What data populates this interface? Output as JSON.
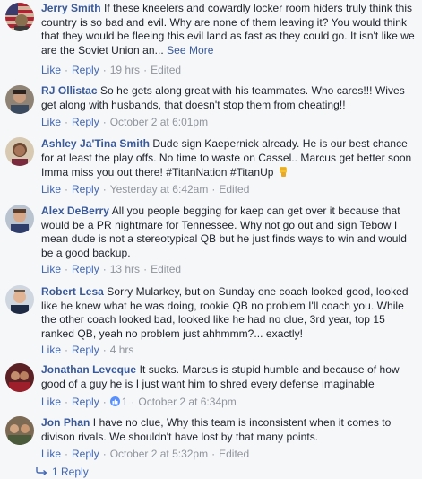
{
  "actions": {
    "like": "Like",
    "reply": "Reply",
    "separator": "·"
  },
  "see_more": "See More",
  "comments": [
    {
      "author": "Jerry Smith",
      "text": "If these kneelers and cowardly locker room hiders truly think this country is so bad and evil. Why are none of them leaving it? You would think that they would be fleeing this evil land as fast as they could go. It isn't like we are the Soviet Union an...",
      "has_see_more": true,
      "timestamp": "19 hrs",
      "edited": "Edited",
      "avatar_icon": "user-avatar-flag"
    },
    {
      "author": "RJ Ollistac",
      "text": "So he gets along great with his teammates. Who cares!!! Wives get along with husbands, that doesn't stop them from cheating!!",
      "timestamp": "October 2 at 6:01pm",
      "avatar_icon": "user-avatar-man"
    },
    {
      "author": "Ashley Ja'Tina Smith",
      "text": "Dude sign Kaepernick already. He is our best chance for at least the play offs. No time to waste on Cassel.. Marcus get better soon Imma miss you out there! #TitanNation #TitanUp",
      "emoji": "raised-fist-emoji",
      "timestamp": "Yesterday at 6:42am",
      "edited": "Edited",
      "avatar_icon": "user-avatar-woman"
    },
    {
      "author": "Alex DeBerry",
      "text": "All you people begging for kaep can get over it because that would be a PR nightmare for Tennessee. Why not go out and sign Tebow I mean dude is not a stereotypical QB but he just finds ways to win and would be a good backup.",
      "timestamp": "13 hrs",
      "edited": "Edited",
      "avatar_icon": "user-avatar-man"
    },
    {
      "author": "Robert Lesa",
      "text": "Sorry Mularkey, but on Sunday one coach looked good, looked like he knew what he was doing, rookie QB no problem I'll coach you. While the other coach looked bad, looked like he had no clue, 3rd year, top 15 ranked QB, yeah no problem just ahhmmm?... exactly!",
      "timestamp": "4 hrs",
      "avatar_icon": "user-avatar-man"
    },
    {
      "author": "Jonathan Leveque",
      "text": "It sucks. Marcus is stupid humble and because of how good of a guy he is I just want him to shred every defense imaginable",
      "like_count": "1",
      "timestamp": "October 2 at 6:34pm",
      "avatar_icon": "user-avatar-group"
    },
    {
      "author": "Jon Phan",
      "text": "I have no clue, Why this team is inconsistent when it comes to divison rivals. We shouldn't have lost by that many points.",
      "timestamp": "October 2 at 5:32pm",
      "edited": "Edited",
      "avatar_icon": "user-avatar-group"
    }
  ],
  "replies_link": "1 Reply",
  "colors": {
    "background": "#f6f7f9",
    "author": "#385898",
    "action_link": "#4267b2",
    "meta": "#90949c",
    "text": "#1d2129"
  }
}
